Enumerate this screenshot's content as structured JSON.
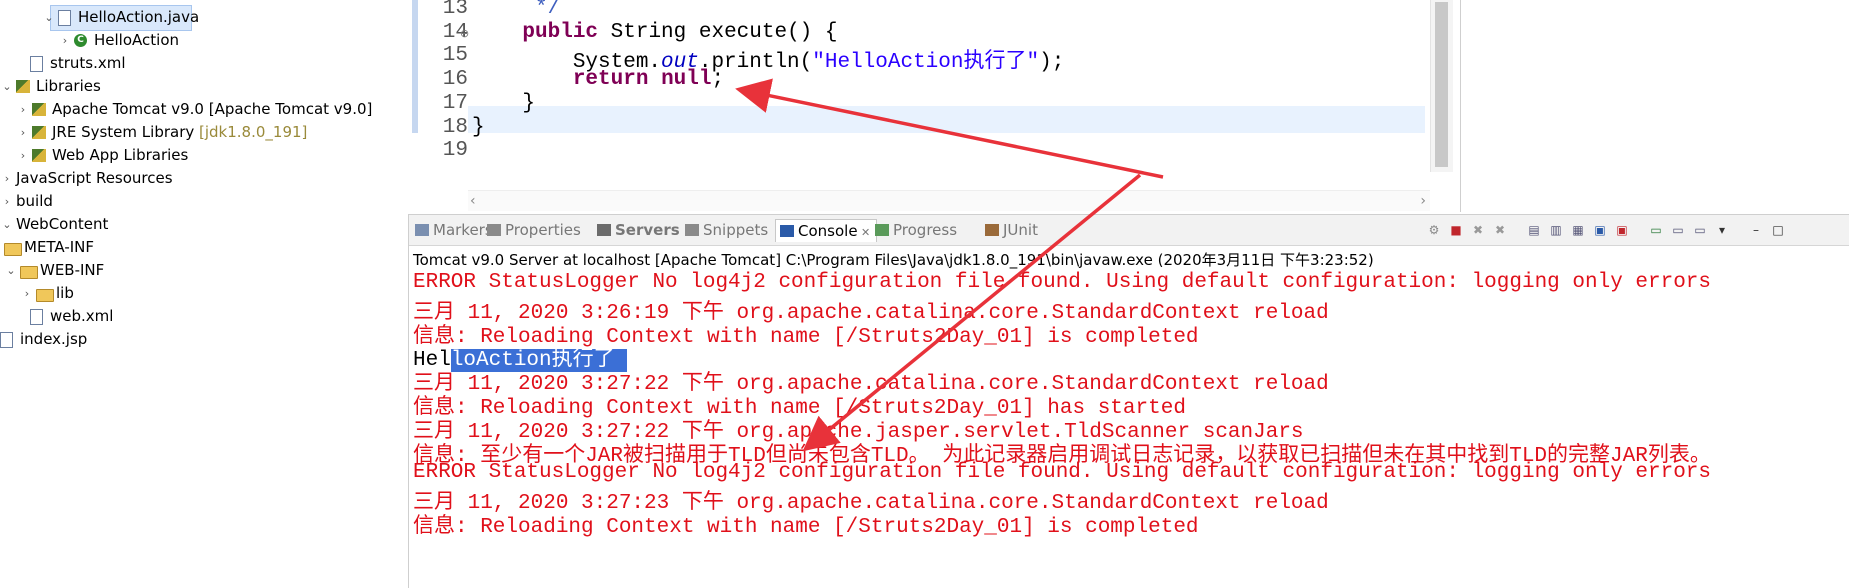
{
  "tree": [
    {
      "name": "helloaction-java",
      "label": "HelloAction.java",
      "icon": "java-file",
      "chevron": "down",
      "indent": 42,
      "selected": true
    },
    {
      "name": "helloaction-class",
      "label": "HelloAction",
      "icon": "class",
      "chevron": "right",
      "indent": 58
    },
    {
      "name": "struts-xml",
      "label": "struts.xml",
      "icon": "xml-file",
      "chevron": "",
      "indent": 30
    },
    {
      "name": "libraries",
      "label": "Libraries",
      "icon": "library",
      "chevron": "down",
      "indent": 0
    },
    {
      "name": "tomcat-lib",
      "label": "Apache Tomcat v9.0 [Apache Tomcat v9.0]",
      "icon": "library",
      "chevron": "right",
      "indent": 16
    },
    {
      "name": "jre-lib",
      "label": "JRE System Library",
      "suffix": "[jdk1.8.0_191]",
      "icon": "library",
      "chevron": "right",
      "indent": 16
    },
    {
      "name": "webapp-lib",
      "label": "Web App Libraries",
      "icon": "library",
      "chevron": "right",
      "indent": 16
    },
    {
      "name": "js-resources",
      "label": "JavaScript Resources",
      "icon": "",
      "chevron": "right",
      "indent": 0
    },
    {
      "name": "build",
      "label": "build",
      "icon": "",
      "chevron": "right",
      "indent": 0
    },
    {
      "name": "webcontent",
      "label": "WebContent",
      "icon": "",
      "chevron": "down",
      "indent": 0
    },
    {
      "name": "meta-inf",
      "label": "META-INF",
      "icon": "folder",
      "chevron": "",
      "indent": 4
    },
    {
      "name": "web-inf",
      "label": "WEB-INF",
      "icon": "folder",
      "chevron": "down",
      "indent": 4
    },
    {
      "name": "lib",
      "label": "lib",
      "icon": "folder",
      "chevron": "right",
      "indent": 20
    },
    {
      "name": "web-xml",
      "label": "web.xml",
      "icon": "xml-file",
      "chevron": "",
      "indent": 30
    },
    {
      "name": "index-jsp",
      "label": "index.jsp",
      "icon": "jsp-file",
      "chevron": "",
      "indent": 0
    }
  ],
  "editor": {
    "line_numbers": [
      "13",
      "14",
      "15",
      "16",
      "17",
      "18",
      "19"
    ],
    "fold_marker": "⊖",
    "lines": [
      [
        {
          "t": "     */",
          "c": "cmt"
        }
      ],
      [
        {
          "t": "    ",
          "c": ""
        },
        {
          "t": "public",
          "c": "kw"
        },
        {
          "t": " String execute() {",
          "c": ""
        }
      ],
      [
        {
          "t": "        System.",
          "c": ""
        },
        {
          "t": "out",
          "c": "fld"
        },
        {
          "t": ".println(",
          "c": ""
        },
        {
          "t": "\"HelloAction执行了\"",
          "c": "str"
        },
        {
          "t": ");",
          "c": ""
        }
      ],
      [
        {
          "t": "        ",
          "c": ""
        },
        {
          "t": "return",
          "c": "kw"
        },
        {
          "t": " ",
          "c": ""
        },
        {
          "t": "null",
          "c": "kw"
        },
        {
          "t": ";",
          "c": ""
        }
      ],
      [
        {
          "t": "    }",
          "c": ""
        }
      ],
      [
        {
          "t": "}",
          "c": ""
        }
      ],
      [
        {
          "t": "",
          "c": ""
        }
      ]
    ]
  },
  "console": {
    "tabs": [
      {
        "name": "tab-markers",
        "label": "Markers",
        "icon": "markers-icon"
      },
      {
        "name": "tab-properties",
        "label": "Properties",
        "icon": "properties-icon"
      },
      {
        "name": "tab-servers",
        "label": "Servers",
        "icon": "servers-icon"
      },
      {
        "name": "tab-snippets",
        "label": "Snippets",
        "icon": "snippets-icon"
      },
      {
        "name": "tab-console",
        "label": "Console",
        "icon": "console-icon",
        "active": true,
        "close": "✕"
      },
      {
        "name": "tab-progress",
        "label": "Progress",
        "icon": "progress-icon"
      },
      {
        "name": "tab-junit",
        "label": "JUnit",
        "icon": "junit-icon"
      }
    ],
    "launch": "Tomcat v9.0 Server at localhost [Apache Tomcat] C:\\Program Files\\Java\\jdk1.8.0_191\\bin\\javaw.exe (2020年3月11日 下午3:23:52)",
    "lines": [
      {
        "text": "ERROR StatusLogger No log4j2 configuration file found. Using default configuration: logging only errors",
        "type": "err"
      },
      {
        "text": "三月 11, 2020 3:26:19 下午 org.apache.catalina.core.StandardContext reload",
        "type": "err"
      },
      {
        "text": "信息: Reloading Context with name [/Struts2Day_01] is completed",
        "type": "err"
      },
      {
        "text": "HelloAction执行了",
        "type": "out",
        "hl_from": 3
      },
      {
        "text": "三月 11, 2020 3:27:22 下午 org.apache.catalina.core.StandardContext reload",
        "type": "err"
      },
      {
        "text": "信息: Reloading Context with name [/Struts2Day_01] has started",
        "type": "err"
      },
      {
        "text": "三月 11, 2020 3:27:22 下午 org.apache.jasper.servlet.TldScanner scanJars",
        "type": "err"
      },
      {
        "text": "信息: 至少有一个JAR被扫描用于TLD但尚未包含TLD。 为此记录器启用调试日志记录，以获取已扫描但未在其中找到TLD的完整JAR列表。",
        "type": "err"
      },
      {
        "text": "ERROR StatusLogger No log4j2 configuration file found. Using default configuration: logging only errors",
        "type": "err"
      },
      {
        "text": "三月 11, 2020 3:27:23 下午 org.apache.catalina.core.StandardContext reload",
        "type": "err"
      },
      {
        "text": "信息: Reloading Context with name [/Struts2Day_01] is completed",
        "type": "err"
      }
    ],
    "toolbar_icons": [
      "pin-icon",
      "terminate-icon",
      "remove-launch-icon",
      "remove-all-icon",
      "clear-console-icon",
      "scroll-lock-icon",
      "word-wrap-icon",
      "show-on-out-icon",
      "show-on-err-icon",
      "open-console-icon",
      "display-console-icon",
      "new-console-icon",
      "view-menu-icon",
      "minimize-icon",
      "maximize-icon"
    ]
  },
  "colors": {
    "error": "#e0101a",
    "annotation": "#e8323a",
    "selection": "#3b6fd6"
  }
}
